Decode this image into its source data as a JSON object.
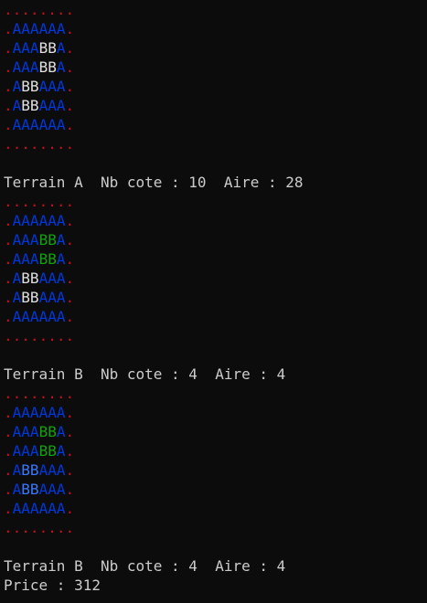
{
  "colors": {
    "background": "#0c0c0c",
    "dot": "#c50f1f",
    "A": "#0037da",
    "B": "#e0e0e0",
    "G": "#13a10e",
    "C": "#3b78ff",
    "text": "#cccccc"
  },
  "grids": [
    {
      "rows": [
        "........",
        ".AAAAAA.",
        ".AAABBA.",
        ".AAABBA.",
        ".ABBAAA.",
        ".ABBAAA.",
        ".AAAAAA.",
        "........"
      ],
      "colors": [
        "dddddddd",
        "dAAAAAAd",
        "dAAABBAd",
        "dAAABBAd",
        "dABBAAAd",
        "dABBAAAd",
        "dAAAAAAd",
        "dddddddd"
      ],
      "summary": "Terrain A  Nb cote : 10  Aire : 28"
    },
    {
      "rows": [
        "........",
        ".AAAAAA.",
        ".AAABBA.",
        ".AAABBA.",
        ".ABBAAA.",
        ".ABBAAA.",
        ".AAAAAA.",
        "........"
      ],
      "colors": [
        "dddddddd",
        "dAAAAAAd",
        "dAAAGGAd",
        "dAAAGGAd",
        "dABBAAAd",
        "dABBAAAd",
        "dAAAAAAd",
        "dddddddd"
      ],
      "summary": "Terrain B  Nb cote : 4  Aire : 4"
    },
    {
      "rows": [
        "........",
        ".AAAAAA.",
        ".AAABBA.",
        ".AAABBA.",
        ".ABBAAA.",
        ".ABBAAA.",
        ".AAAAAA.",
        "........"
      ],
      "colors": [
        "dddddddd",
        "dAAAAAAd",
        "dAAAGGAd",
        "dAAAGGAd",
        "dACCAAAd",
        "dACCAAAd",
        "dAAAAAAd",
        "dddddddd"
      ],
      "summary": "Terrain B  Nb cote : 4  Aire : 4"
    }
  ],
  "price_line": "Price : 312"
}
